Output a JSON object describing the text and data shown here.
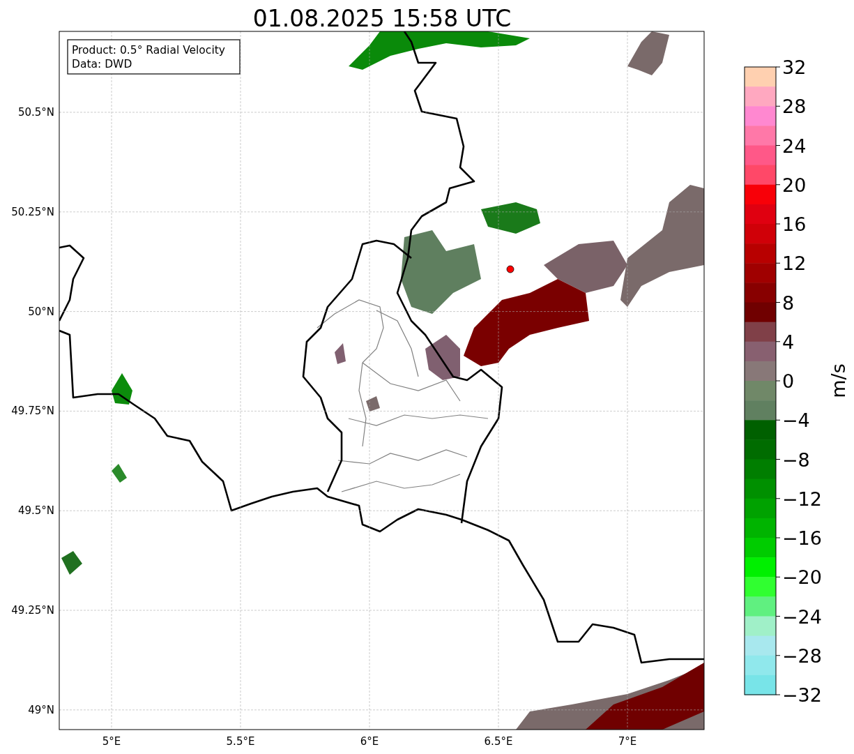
{
  "title": "01.08.2025 15:58 UTC",
  "legend": [
    "Product: 0.5° Radial Velocity",
    "Data: DWD"
  ],
  "x_ticks": [
    "5°E",
    "5.5°E",
    "6°E",
    "6.5°E",
    "7°E"
  ],
  "y_ticks": [
    "50.5°N",
    "50.25°N",
    "50°N",
    "49.75°N",
    "49.5°N",
    "49.25°N",
    "49°N"
  ],
  "colorbar": {
    "label": "m/s",
    "ticks": [
      "32",
      "28",
      "24",
      "20",
      "16",
      "12",
      "8",
      "4",
      "0",
      "−4",
      "−8",
      "−12",
      "−16",
      "−20",
      "−24",
      "−28",
      "−32"
    ],
    "segments": [
      {
        "color": "#ffd0b0"
      },
      {
        "color": "#ffa8c0"
      },
      {
        "color": "#ff88d0"
      },
      {
        "color": "#ff78a8"
      },
      {
        "color": "#ff5888"
      },
      {
        "color": "#ff4868"
      },
      {
        "color": "#f80008"
      },
      {
        "color": "#e00010"
      },
      {
        "color": "#d00008"
      },
      {
        "color": "#b80000"
      },
      {
        "color": "#a00000"
      },
      {
        "color": "#880000"
      },
      {
        "color": "#700000"
      },
      {
        "color": "#804048"
      },
      {
        "color": "#886070"
      },
      {
        "color": "#887878"
      },
      {
        "color": "#708868"
      },
      {
        "color": "#608060"
      },
      {
        "color": "#006000"
      },
      {
        "color": "#006c00"
      },
      {
        "color": "#007e00"
      },
      {
        "color": "#009000"
      },
      {
        "color": "#00a200"
      },
      {
        "color": "#00b400"
      },
      {
        "color": "#00cc00"
      },
      {
        "color": "#00f000"
      },
      {
        "color": "#30ff30"
      },
      {
        "color": "#60f080"
      },
      {
        "color": "#a0f0c8"
      },
      {
        "color": "#a8e8ee"
      },
      {
        "color": "#90e8ec"
      },
      {
        "color": "#78e4e8"
      }
    ]
  }
}
